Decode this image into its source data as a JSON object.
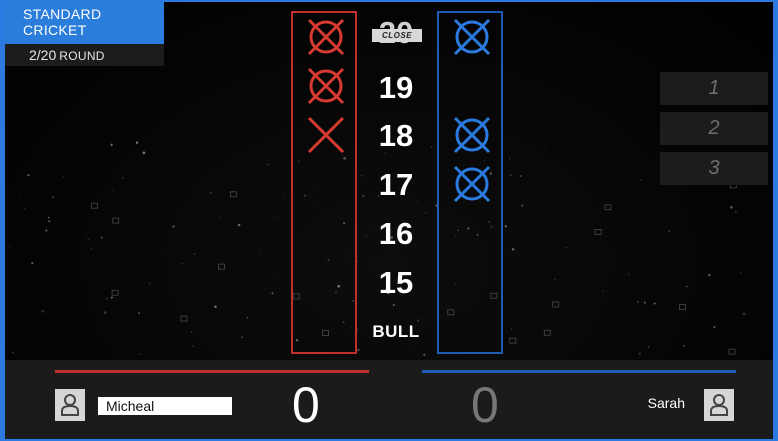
{
  "game": {
    "mode_title": "STANDARD CRICKET",
    "round_count": "2/20",
    "round_word": "ROUND",
    "close_label": "CLOSE"
  },
  "colors": {
    "player1": "#c0302c",
    "player2": "#1f5db4",
    "mark_red": "#d63a30",
    "mark_blue": "#2a7ae0"
  },
  "board": {
    "numbers": [
      "20",
      "19",
      "18",
      "17",
      "16",
      "15",
      "BULL"
    ],
    "player1_marks": [
      3,
      3,
      2,
      0,
      0,
      0,
      0
    ],
    "player2_marks": [
      3,
      0,
      3,
      3,
      0,
      0,
      0
    ]
  },
  "throws": [
    "1",
    "2",
    "3"
  ],
  "players": [
    {
      "name": "Micheal",
      "score": "0",
      "avatar_icon": "user-icon"
    },
    {
      "name": "Sarah",
      "score": "0",
      "avatar_icon": "user-icon"
    }
  ]
}
